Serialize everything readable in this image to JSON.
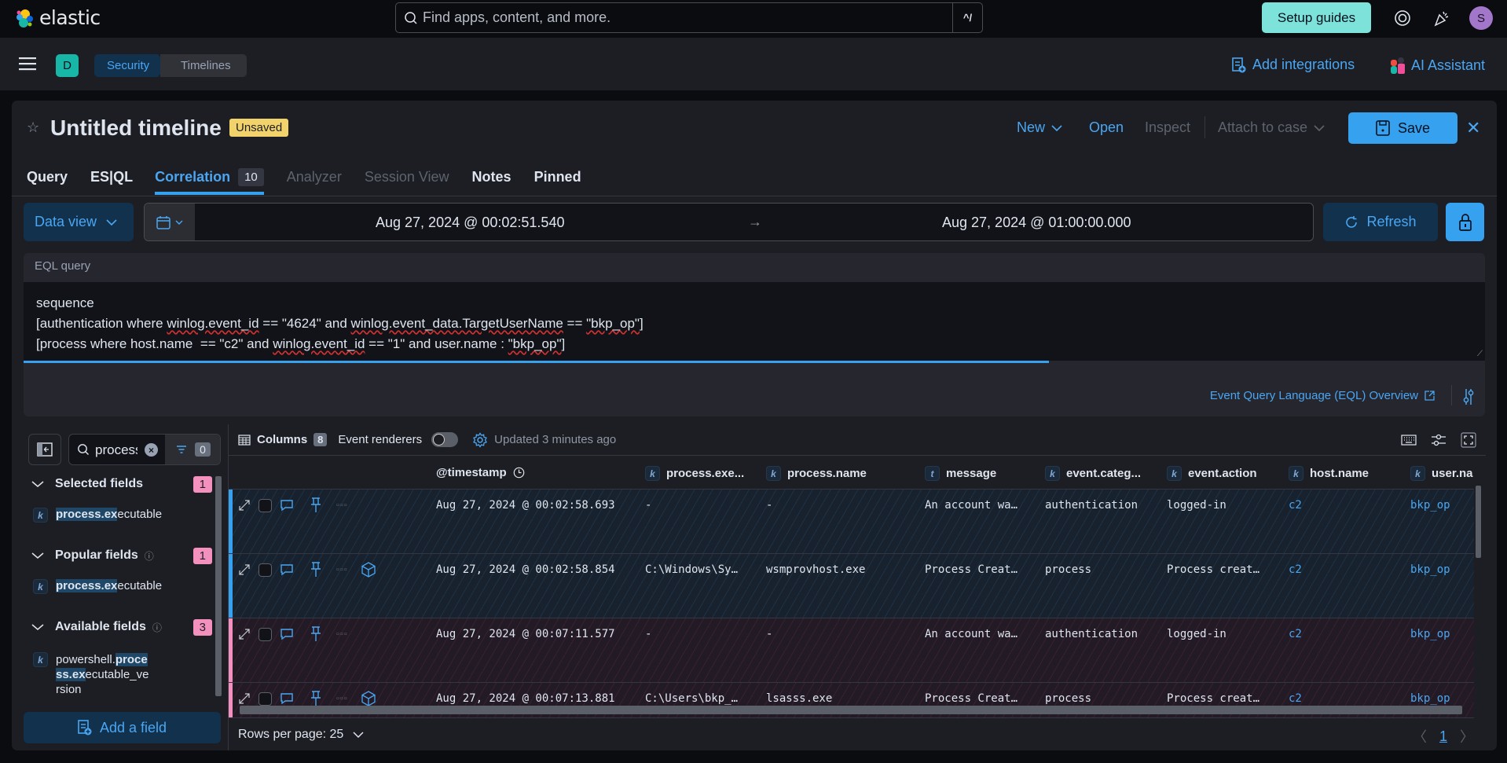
{
  "topbar": {
    "logo_text": "elastic",
    "search_placeholder": "Find apps, content, and more.",
    "search_shortcut": "^/",
    "setup_guides": "Setup guides",
    "avatar_initial": "S"
  },
  "navbar": {
    "space_initial": "D",
    "breadcrumbs": [
      "Security",
      "Timelines"
    ],
    "add_integrations": "Add integrations",
    "ai_assistant": "AI Assistant"
  },
  "timeline": {
    "title": "Untitled timeline",
    "status_badge": "Unsaved",
    "actions": {
      "new": "New",
      "open": "Open",
      "inspect": "Inspect",
      "attach_to_case": "Attach to case",
      "save": "Save"
    },
    "tabs": [
      {
        "label": "Query",
        "state": "normal"
      },
      {
        "label": "ES|QL",
        "state": "normal"
      },
      {
        "label": "Correlation",
        "state": "active",
        "count": "10"
      },
      {
        "label": "Analyzer",
        "state": "disabled"
      },
      {
        "label": "Session View",
        "state": "disabled"
      },
      {
        "label": "Notes",
        "state": "normal"
      },
      {
        "label": "Pinned",
        "state": "normal"
      }
    ]
  },
  "query_bar": {
    "data_view": "Data view",
    "start_date": "Aug 27, 2024 @ 00:02:51.540",
    "end_date": "Aug 27, 2024 @ 01:00:00.000",
    "refresh": "Refresh"
  },
  "eql": {
    "label": "EQL query",
    "lines": [
      "sequence",
      "[authentication where winlog.event_id == \"4624\" and winlog.event_data.TargetUserName == \"bkp_op\"]",
      "[process where host.name  == \"c2\" and winlog.event_id == \"1\" and user.name : \"bkp_op\"]"
    ],
    "overview_link": "Event Query Language (EQL) Overview"
  },
  "sidebar": {
    "search_value": "process.ex",
    "filter_count": "0",
    "sections": [
      {
        "title": "Selected fields",
        "count": "1",
        "fields": [
          {
            "type": "k",
            "prefix": "",
            "match": "process.ex",
            "suffix": "ecutable"
          }
        ]
      },
      {
        "title": "Popular fields",
        "count": "1",
        "fields": [
          {
            "type": "k",
            "prefix": "",
            "match": "process.ex",
            "suffix": "ecutable"
          }
        ]
      },
      {
        "title": "Available fields",
        "count": "3",
        "fields": [
          {
            "type": "k",
            "prefix": "powershell.",
            "match": "process.ex",
            "suffix": "ecutable_version"
          }
        ]
      }
    ],
    "add_field": "Add a field"
  },
  "grid": {
    "columns_label": "Columns",
    "columns_count": "8",
    "event_renderers": "Event renderers",
    "event_renderers_on": false,
    "updated": "Updated 3 minutes ago",
    "headers": [
      {
        "type": "",
        "label": "@timestamp"
      },
      {
        "type": "k",
        "label": "process.exe..."
      },
      {
        "type": "k",
        "label": "process.name"
      },
      {
        "type": "t",
        "label": "message"
      },
      {
        "type": "k",
        "label": "event.categ..."
      },
      {
        "type": "k",
        "label": "event.action"
      },
      {
        "type": "k",
        "label": "host.name"
      },
      {
        "type": "k",
        "label": "user.nar"
      }
    ],
    "rows": [
      {
        "group": "blue",
        "has_session": false,
        "timestamp": "Aug 27, 2024 @ 00:02:58.693",
        "process_executable": "-",
        "process_name": "-",
        "message": "An account wa…",
        "event_category": "authentication",
        "event_action": "logged-in",
        "host_name": "c2",
        "user_name": "bkp_op"
      },
      {
        "group": "blue",
        "has_session": true,
        "timestamp": "Aug 27, 2024 @ 00:02:58.854",
        "process_executable": "C:\\Windows\\Sy…",
        "process_name": "wsmprovhost.exe",
        "message": "Process Creat…",
        "event_category": "process",
        "event_action": "Process creat…",
        "host_name": "c2",
        "user_name": "bkp_op"
      },
      {
        "group": "pink",
        "has_session": false,
        "timestamp": "Aug 27, 2024 @ 00:07:11.577",
        "process_executable": "-",
        "process_name": "-",
        "message": "An account wa…",
        "event_category": "authentication",
        "event_action": "logged-in",
        "host_name": "c2",
        "user_name": "bkp_op"
      },
      {
        "group": "pink",
        "has_session": true,
        "timestamp": "Aug 27, 2024 @ 00:07:13.881",
        "process_executable": "C:\\Users\\bkp_…",
        "process_name": "lsasss.exe",
        "message": "Process Creat…",
        "event_category": "process",
        "event_action": "Process creat…",
        "host_name": "c2",
        "user_name": "bkp_op"
      }
    ],
    "rows_per_page": "Rows per page: 25",
    "current_page": "1"
  }
}
